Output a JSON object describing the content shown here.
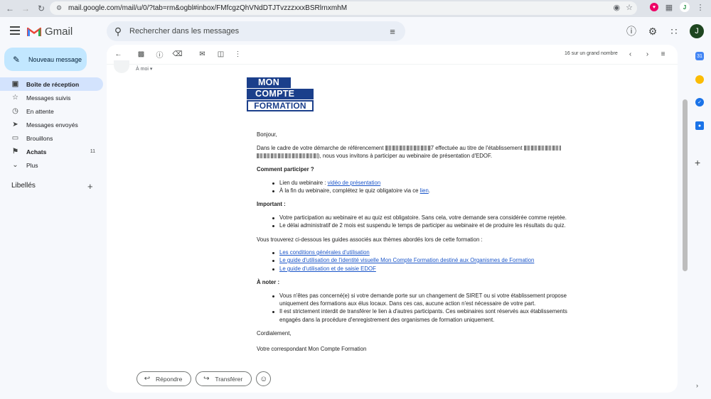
{
  "browser": {
    "url": "mail.google.com/mail/u/0/?tab=rm&ogbl#inbox/FMfcgzQhVNdDTJTvzzzxxxBSRlrnxmhM",
    "avatar_letter": "J"
  },
  "header": {
    "app_name": "Gmail",
    "search_placeholder": "Rechercher dans les messages",
    "avatar_letter": "J"
  },
  "sidebar": {
    "compose_label": "Nouveau message",
    "items": [
      {
        "label": "Boîte de réception",
        "icon": "inbox-icon",
        "active": true
      },
      {
        "label": "Messages suivis",
        "icon": "star-icon"
      },
      {
        "label": "En attente",
        "icon": "clock-icon"
      },
      {
        "label": "Messages envoyés",
        "icon": "send-icon"
      },
      {
        "label": "Brouillons",
        "icon": "draft-icon"
      },
      {
        "label": "Achats",
        "icon": "tag-icon",
        "count": "11"
      },
      {
        "label": "Plus",
        "icon": "chevron-down-icon"
      }
    ],
    "labels_header": "Libellés"
  },
  "toolbar": {
    "page_count": "16 sur un grand nombre"
  },
  "message": {
    "to_me": "À moi",
    "logo": {
      "line1": "MON",
      "line2": "COMPTE",
      "line3": "FORMATION"
    },
    "greeting": "Bonjour,",
    "intro_1a": "Dans le cadre de votre démarche de référencement",
    "intro_1b": "7 effectuée au titre de l'établissement",
    "intro_2": "), nous vous invitons à participer au webinaire de présentation d'EDOF.",
    "how_title": "Comment participer ?",
    "how_1_text": "Lien du webinaire : ",
    "how_1_link": "vidéo de présentation",
    "how_2_text": "À la fin du webinaire, complétez le quiz obligatoire via ce ",
    "how_2_link": "lien",
    "how_2_end": ".",
    "important_title": "Important :",
    "important_1": "Votre participation au webinaire et au quiz est obligatoire. Sans cela, votre demande sera considérée comme rejetée.",
    "important_2": "Le délai administratif de 2 mois est suspendu le temps de participer au webinaire et de produire les résultats du quiz.",
    "guides_intro": "Vous trouverez ci-dessous les guides associés aux thèmes abordés lors de cette formation :",
    "guide_links": [
      "Les conditions générales d'utilisation",
      "Le guide d'utilisation de l'identité visuelle Mon Compte Formation destiné aux Organismes de Formation",
      "Le guide d'utilisation et de saisie EDOF"
    ],
    "note_title": "À noter :",
    "note_1a": "Vous n'êtes pas concerné(e) si votre demande porte sur un changement de SIRET ou si votre établissement propose",
    "note_1b": "uniquement des formations aux élus locaux. Dans ces cas, aucune action n'est nécessaire de votre part.",
    "note_2a": "Il est strictement interdit de transférer le lien à d'autres participants. Ces webinaires sont réservés aux établissements",
    "note_2b": "engagés dans la procédure d'enregistrement des organismes de formation uniquement.",
    "closing": "Cordialement,",
    "signature": "Votre correspondant Mon Compte Formation"
  },
  "actions": {
    "reply_label": "Répondre",
    "forward_label": "Transférer"
  },
  "colors": {
    "accent": "#c2e7ff",
    "active_nav": "#d3e3fd",
    "brand_blue": "#1b3f8b",
    "link": "#1a55c9"
  }
}
